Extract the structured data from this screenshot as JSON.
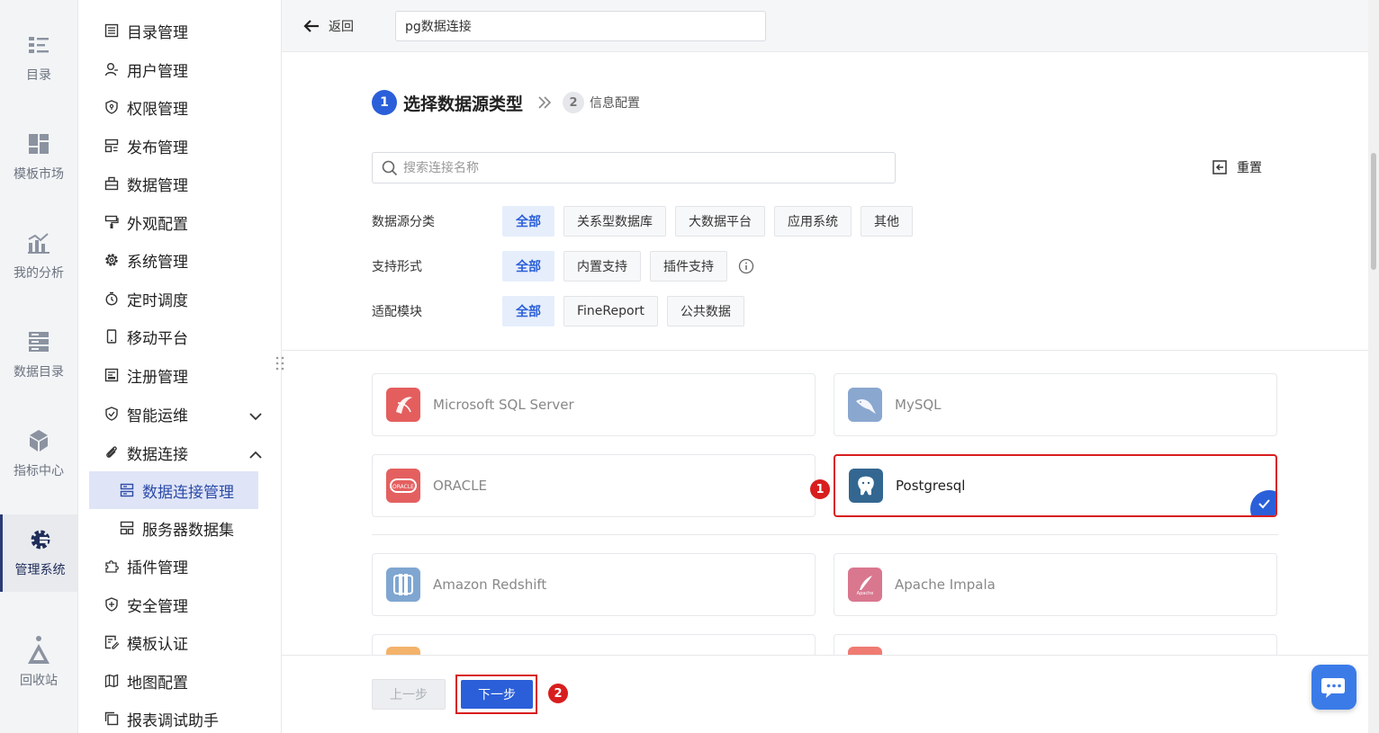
{
  "rail": {
    "items": [
      {
        "label": "目录",
        "icon": "catalog-icon"
      },
      {
        "label": "模板市场",
        "icon": "template-market-icon"
      },
      {
        "label": "我的分析",
        "icon": "analysis-icon"
      },
      {
        "label": "数据目录",
        "icon": "data-catalog-icon"
      },
      {
        "label": "指标中心",
        "icon": "metric-center-icon"
      },
      {
        "label": "管理系统",
        "icon": "management-gear-icon"
      },
      {
        "label": "回收站",
        "icon": "recycle-bin-icon"
      }
    ]
  },
  "menu": {
    "items": [
      {
        "label": "目录管理"
      },
      {
        "label": "用户管理"
      },
      {
        "label": "权限管理"
      },
      {
        "label": "发布管理"
      },
      {
        "label": "数据管理"
      },
      {
        "label": "外观配置"
      },
      {
        "label": "系统管理"
      },
      {
        "label": "定时调度"
      },
      {
        "label": "移动平台"
      },
      {
        "label": "注册管理"
      },
      {
        "label": "智能运维"
      },
      {
        "label": "数据连接"
      },
      {
        "label": "数据连接管理"
      },
      {
        "label": "服务器数据集"
      },
      {
        "label": "插件管理"
      },
      {
        "label": "安全管理"
      },
      {
        "label": "模板认证"
      },
      {
        "label": "地图配置"
      },
      {
        "label": "报表调试助手"
      }
    ]
  },
  "topbar": {
    "back_label": "返回",
    "connection_name": "pg数据连接"
  },
  "steps": {
    "step1_num": "1",
    "step1_title": "选择数据源类型",
    "step2_num": "2",
    "step2_title": "信息配置"
  },
  "search": {
    "placeholder": "搜索连接名称",
    "reset_label": "重置"
  },
  "filters": {
    "category": {
      "label": "数据源分类",
      "options": [
        "全部",
        "关系型数据库",
        "大数据平台",
        "应用系统",
        "其他"
      ],
      "selected": "全部"
    },
    "support": {
      "label": "支持形式",
      "options": [
        "全部",
        "内置支持",
        "插件支持"
      ],
      "selected": "全部"
    },
    "module": {
      "label": "适配模块",
      "options": [
        "全部",
        "FineReport",
        "公共数据"
      ],
      "selected": "全部"
    }
  },
  "datasources": [
    {
      "name": "Microsoft SQL Server",
      "color": "#e45e5e"
    },
    {
      "name": "MySQL",
      "color": "#8aa7cf"
    },
    {
      "name": "ORACLE",
      "color": "#e46060"
    },
    {
      "name": "Postgresql",
      "color": "#336791",
      "selected": true
    },
    {
      "name": "Amazon Redshift",
      "color": "#7fa6d1"
    },
    {
      "name": "Apache Impala",
      "color": "#d9778f"
    }
  ],
  "annotations": {
    "badge1": "1",
    "badge2": "2"
  },
  "footer": {
    "prev_label": "上一步",
    "next_label": "下一步"
  },
  "colors": {
    "primary": "#2b5fd9",
    "highlight_red": "#d81e1e",
    "chip_active_bg": "#e6eefc"
  }
}
